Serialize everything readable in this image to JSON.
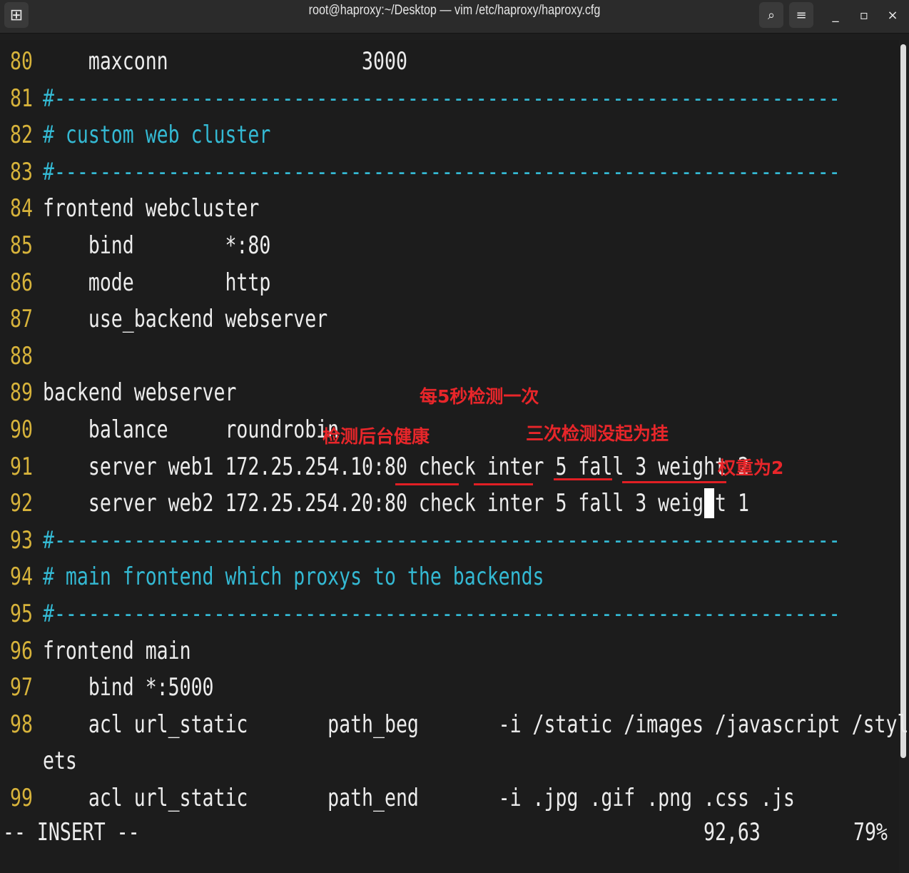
{
  "window": {
    "title": "root@haproxy:~/Desktop — vim /etc/haproxy/haproxy.cfg",
    "new_tab_icon": "⊞",
    "search_icon": "⌕",
    "menu_icon": "≡",
    "minimize_icon": "_",
    "maximize_icon": "▫",
    "close_icon": "×"
  },
  "editor": {
    "lines": [
      {
        "n": "80",
        "text": "    maxconn                 3000",
        "comment": false
      },
      {
        "n": "81",
        "text": "#---------------------------------------------------------------------",
        "comment": true
      },
      {
        "n": "82",
        "text": "# custom web cluster",
        "comment": true
      },
      {
        "n": "83",
        "text": "#---------------------------------------------------------------------",
        "comment": true
      },
      {
        "n": "84",
        "text": "frontend webcluster",
        "comment": false
      },
      {
        "n": "85",
        "text": "    bind        *:80",
        "comment": false
      },
      {
        "n": "86",
        "text": "    mode        http",
        "comment": false
      },
      {
        "n": "87",
        "text": "    use_backend webserver",
        "comment": false
      },
      {
        "n": "88",
        "text": "",
        "comment": false
      },
      {
        "n": "89",
        "text": "backend webserver",
        "comment": false
      },
      {
        "n": "90",
        "text": "    balance     roundrobin",
        "comment": false
      },
      {
        "n": "91",
        "text": "    server web1 172.25.254.10:80 check inter 5 fall 3 weight 2",
        "comment": false
      },
      {
        "n": "92",
        "text": "    server web2 172.25.254.20:80 check inter 5 fall 3 weight 1",
        "comment": false
      },
      {
        "n": "93",
        "text": "#---------------------------------------------------------------------",
        "comment": true
      },
      {
        "n": "94",
        "text": "# main frontend which proxys to the backends",
        "comment": true
      },
      {
        "n": "95",
        "text": "#---------------------------------------------------------------------",
        "comment": true
      },
      {
        "n": "96",
        "text": "frontend main",
        "comment": false
      },
      {
        "n": "97",
        "text": "    bind *:5000",
        "comment": false
      },
      {
        "n": "98",
        "text": "    acl url_static       path_beg       -i /static /images /javascript /styleshe",
        "comment": false
      },
      {
        "n": "",
        "text": "ets",
        "comment": false
      },
      {
        "n": "99",
        "text": "    acl url_static       path_end       -i .jpg .gif .png .css .js",
        "comment": false
      }
    ]
  },
  "annotations": {
    "every_5s": "每5秒检测一次",
    "health_check": "检测后台健康",
    "three_fails": "三次检测没起为挂",
    "weight_2": "权重为2"
  },
  "statusline": {
    "mode": "-- INSERT --",
    "position": "92,63",
    "percent": "79%"
  },
  "colors": {
    "line_number": "#d7b33b",
    "comment": "#34b9d3",
    "text": "#ececec",
    "annotation": "#e8262a"
  }
}
